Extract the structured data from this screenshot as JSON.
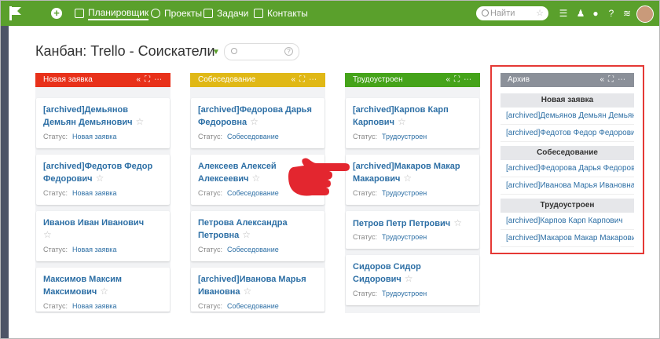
{
  "topbar": {
    "nav": [
      {
        "label": "Планировщик",
        "icon": "calendar-grid-icon",
        "active": true
      },
      {
        "label": "Проекты",
        "icon": "database-icon",
        "active": false
      },
      {
        "label": "Задачи",
        "icon": "checkbox-icon",
        "active": false
      },
      {
        "label": "Контакты",
        "icon": "contact-card-icon",
        "active": false
      }
    ],
    "search_placeholder": "Найти",
    "colors": {
      "brand": "#5aa02c"
    }
  },
  "board": {
    "title": "Канбан: Trello - Соискатели",
    "status_label": "Статус:",
    "columns": [
      {
        "name": "Новая заявка",
        "color": "#e8311a",
        "cards": [
          {
            "name": "[archived]Демьянов Демьян Демьянович",
            "status": "Новая заявка"
          },
          {
            "name": "[archived]Федотов Федор Федорович",
            "status": "Новая заявка"
          },
          {
            "name": "Иванов Иван Иванович",
            "status": "Новая заявка"
          },
          {
            "name": "Максимов Максим Максимович",
            "status": "Новая заявка"
          }
        ]
      },
      {
        "name": "Собеседование",
        "color": "#e0b816",
        "cards": [
          {
            "name": "[archived]Федорова Дарья Федоровна",
            "status": "Собеседование"
          },
          {
            "name": "Алексеев Алексей Алексеевич",
            "status": "Собеседование"
          },
          {
            "name": "Петрова Александра Петровна",
            "status": "Собеседование"
          },
          {
            "name": "[archived]Иванова Марья Ивановна",
            "status": "Собеседование"
          }
        ]
      },
      {
        "name": "Трудоустроен",
        "color": "#45a31a",
        "cards": [
          {
            "name": "[archived]Карпов Карп Карпович",
            "status": "Трудоустроен"
          },
          {
            "name": "[archived]Макаров Макар Макарович",
            "status": "Трудоустроен"
          },
          {
            "name": "Петров Петр Петрович",
            "status": "Трудоустроен"
          },
          {
            "name": "Сидоров Сидор Сидорович",
            "status": "Трудоустроен"
          }
        ]
      }
    ],
    "archive": {
      "name": "Архив",
      "groups": [
        {
          "title": "Новая заявка",
          "items": [
            "[archived]Демьянов Демьян Демьянович",
            "[archived]Федотов Федор Федорович"
          ]
        },
        {
          "title": "Собеседование",
          "items": [
            "[archived]Федорова Дарья Федоровна",
            "[archived]Иванова Марья Ивановна"
          ]
        },
        {
          "title": "Трудоустроен",
          "items": [
            "[archived]Карпов Карп Карпович",
            "[archived]Макаров Макар Макарович"
          ]
        }
      ]
    }
  }
}
